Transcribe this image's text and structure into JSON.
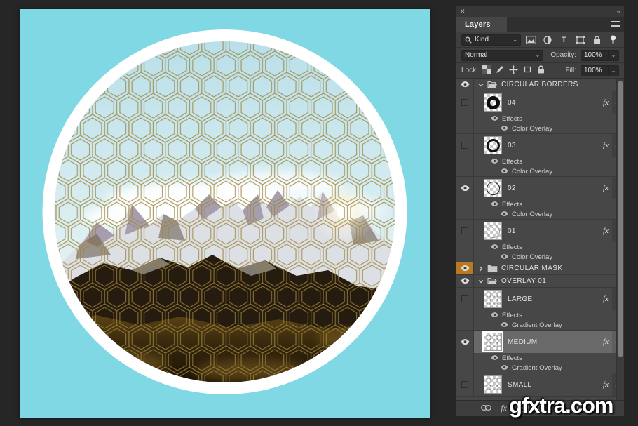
{
  "canvas": {
    "background_color": "#7fd8e3",
    "ring_color": "#ffffff",
    "pattern_color": "#9c8339",
    "description": "circular masked mountain photo with gold geometric pattern overlay"
  },
  "glyphs": {
    "close": "✕",
    "collapse": "«",
    "dropdown": "⌄",
    "type_filter": "T"
  },
  "panel": {
    "title": "Layers",
    "filter_label": "Kind",
    "blend_mode": "Normal",
    "opacity_label": "Opacity:",
    "opacity_value": "100%",
    "lock_label": "Lock:",
    "fill_label": "Fill:",
    "fill_value": "100%",
    "fx_badge": "fx",
    "rows": [
      {
        "kind": "group",
        "name": "CIRCULAR BORDERS",
        "visible": true,
        "expanded": true,
        "labelColor": null
      },
      {
        "kind": "layer",
        "name": "04",
        "visible": false,
        "labelColor": "blue",
        "thumb": "ring-4",
        "fx": true,
        "effects": [
          "Effects",
          "Color Overlay"
        ]
      },
      {
        "kind": "layer",
        "name": "03",
        "visible": false,
        "labelColor": "blue",
        "thumb": "ring-3",
        "fx": true,
        "effects": [
          "Effects",
          "Color Overlay"
        ]
      },
      {
        "kind": "layer",
        "name": "02",
        "visible": true,
        "labelColor": "blue",
        "thumb": "ring-2",
        "fx": true,
        "effects": [
          "Effects",
          "Color Overlay"
        ]
      },
      {
        "kind": "layer",
        "name": "01",
        "visible": false,
        "labelColor": "blue",
        "thumb": "ring-1",
        "fx": true,
        "effects": [
          "Effects",
          "Color Overlay"
        ]
      },
      {
        "kind": "group",
        "name": "CIRCULAR MASK",
        "visible": true,
        "expanded": false,
        "labelColor": "orange"
      },
      {
        "kind": "group",
        "name": "OVERLAY 01",
        "visible": true,
        "expanded": true,
        "labelColor": null
      },
      {
        "kind": "layer",
        "name": "LARGE",
        "visible": false,
        "labelColor": null,
        "thumb": "pattern",
        "fx": true,
        "effects": [
          "Effects",
          "Gradient Overlay"
        ]
      },
      {
        "kind": "layer",
        "name": "MEDIUM",
        "visible": true,
        "selected": true,
        "labelColor": null,
        "thumb": "pattern",
        "fx": true,
        "effects": [
          "Effects",
          "Gradient Overlay"
        ]
      },
      {
        "kind": "layer",
        "name": "SMALL",
        "visible": false,
        "labelColor": null,
        "thumb": "pattern",
        "fx": true,
        "effects": []
      }
    ]
  },
  "colors": {
    "label_blue": "#5d79a5",
    "label_orange": "#b8791f",
    "selected_row": "#696969"
  },
  "watermark": "gfxtra.com"
}
